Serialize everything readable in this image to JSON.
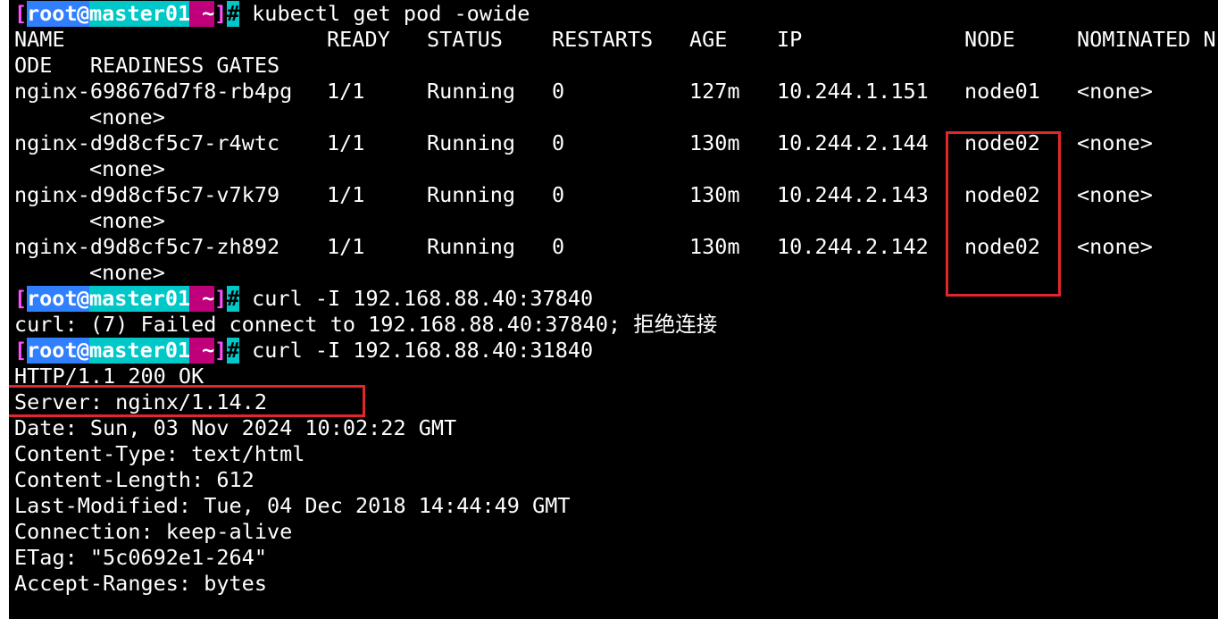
{
  "prompt": {
    "open": "[",
    "user": "root",
    "at": "@",
    "host": "master01",
    "dir": " ~",
    "close": "]",
    "hash": "#"
  },
  "commands": {
    "get_pod": " kubectl get pod -owide",
    "curl_bad": " curl -I 192.168.88.40:37840",
    "curl_good": " curl -I 192.168.88.40:31840"
  },
  "table": {
    "headers": [
      "NAME",
      "READY",
      "STATUS",
      "RESTARTS",
      "AGE",
      "IP",
      "NODE",
      "NOMINATED N"
    ],
    "header_wrap": "ODE   READINESS GATES",
    "rows": [
      {
        "name": "nginx-698676d7f8-rb4pg",
        "ready": "1/1",
        "status": "Running",
        "restarts": "0",
        "age": "127m",
        "ip": "10.244.1.151",
        "node": "node01",
        "nominated": "<none>",
        "gates": "<none>"
      },
      {
        "name": "nginx-d9d8cf5c7-r4wtc",
        "ready": "1/1",
        "status": "Running",
        "restarts": "0",
        "age": "130m",
        "ip": "10.244.2.144",
        "node": "node02",
        "nominated": "<none>",
        "gates": "<none>"
      },
      {
        "name": "nginx-d9d8cf5c7-v7k79",
        "ready": "1/1",
        "status": "Running",
        "restarts": "0",
        "age": "130m",
        "ip": "10.244.2.143",
        "node": "node02",
        "nominated": "<none>",
        "gates": "<none>"
      },
      {
        "name": "nginx-d9d8cf5c7-zh892",
        "ready": "1/1",
        "status": "Running",
        "restarts": "0",
        "age": "130m",
        "ip": "10.244.2.142",
        "node": "node02",
        "nominated": "<none>",
        "gates": "<none>"
      }
    ]
  },
  "output": {
    "curl_error": "curl: (7) Failed connect to 192.168.88.40:37840; 拒绝连接",
    "http_lines": [
      "HTTP/1.1 200 OK",
      "Server: nginx/1.14.2",
      "Date: Sun, 03 Nov 2024 10:02:22 GMT",
      "Content-Type: text/html",
      "Content-Length: 612",
      "Last-Modified: Tue, 04 Dec 2018 14:44:49 GMT",
      "Connection: keep-alive",
      "ETag: \"5c0692e1-264\"",
      "Accept-Ranges: bytes"
    ]
  },
  "colors": {
    "background": "#000000",
    "text": "#ffffff",
    "highlight": "#e3262b"
  }
}
